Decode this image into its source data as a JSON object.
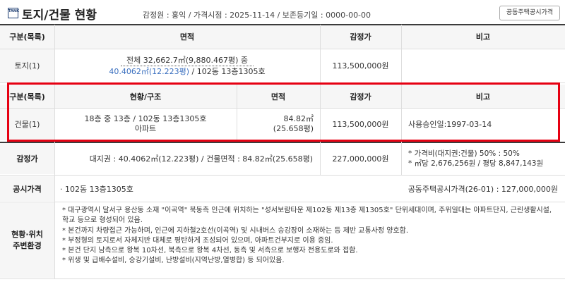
{
  "header": {
    "logo_text": "TANK",
    "title": "토지/건물 현황",
    "meta": "감정원 : 홍익 / 가격시점 : 2025-11-14 / 보존등기일 : 0000-00-00",
    "button_label": "공동주택공시가격"
  },
  "land_table": {
    "headers": [
      "구분(목록)",
      "면적",
      "감정가",
      "비고"
    ],
    "row": {
      "category": "토지(1)",
      "area_line1": "전체 32,662.7㎡(9,880.467평) 중",
      "area_line2_blue": "40.4062㎡(12.223평)",
      "area_line2_rest": " / 102동 13층1305호",
      "price": "113,500,000원",
      "note": ""
    }
  },
  "building_table": {
    "headers": [
      "구분(목록)",
      "현황/구조",
      "면적",
      "감정가",
      "비고"
    ],
    "row": {
      "category": "건물(1)",
      "structure_line1": "18층 중 13층 / 102동 13층1305호",
      "structure_line2": "아파트",
      "area_line1": "84.82㎡",
      "area_line2": "(25.658평)",
      "price": "113,500,000원",
      "note": "사용승인일:1997-03-14"
    }
  },
  "appraisal": {
    "label": "감정가",
    "detail": "대지권 : 40.4062㎡(12.223평) / 건물면적 : 84.82㎡(25.658평)",
    "price": "227,000,000원",
    "note_line1": "* 가격비(대지권:건물) 50% : 50%",
    "note_line2": "* ㎡당 2,676,256원 / 평당 8,847,143원"
  },
  "public_price": {
    "label": "공시가격",
    "unit": "· 102동 13층1305호",
    "value": "공동주택공시가격(26-01) : 127,000,000원"
  },
  "surroundings": {
    "label_line1": "현황·위치",
    "label_line2": "주변환경",
    "notes": [
      "* 대구광역시 달서구 용산동 소재 \"이곡역\" 북동측 인근에 위치하는 \"성서보람타운 제102동 제13층 제1305호\" 단위세대이며, 주위일대는 아파트단지, 근린생활시설, 학교 등으로 형성되어 있음.",
      "* 본건까지 차량접근 가능하며, 인근에 지하철2호선(이곡역) 및 시내버스 승강장이 소재하는 등 제반 교통사정 양호함.",
      "* 부정형의 토지로서 자체지반 대체로 평탄하게 조성되어 있으며, 아파트건부지로 이용 중임.",
      "* 본건 단지 남측으로 왕복 10차선, 북측으로 왕복 4차선, 동측 및 서측으로 보행자 전용도로와 접함.",
      "* 위생 및 급배수설비, 승강기설비, 난방설비(지역난방,열병합) 등 되어있음."
    ]
  }
}
